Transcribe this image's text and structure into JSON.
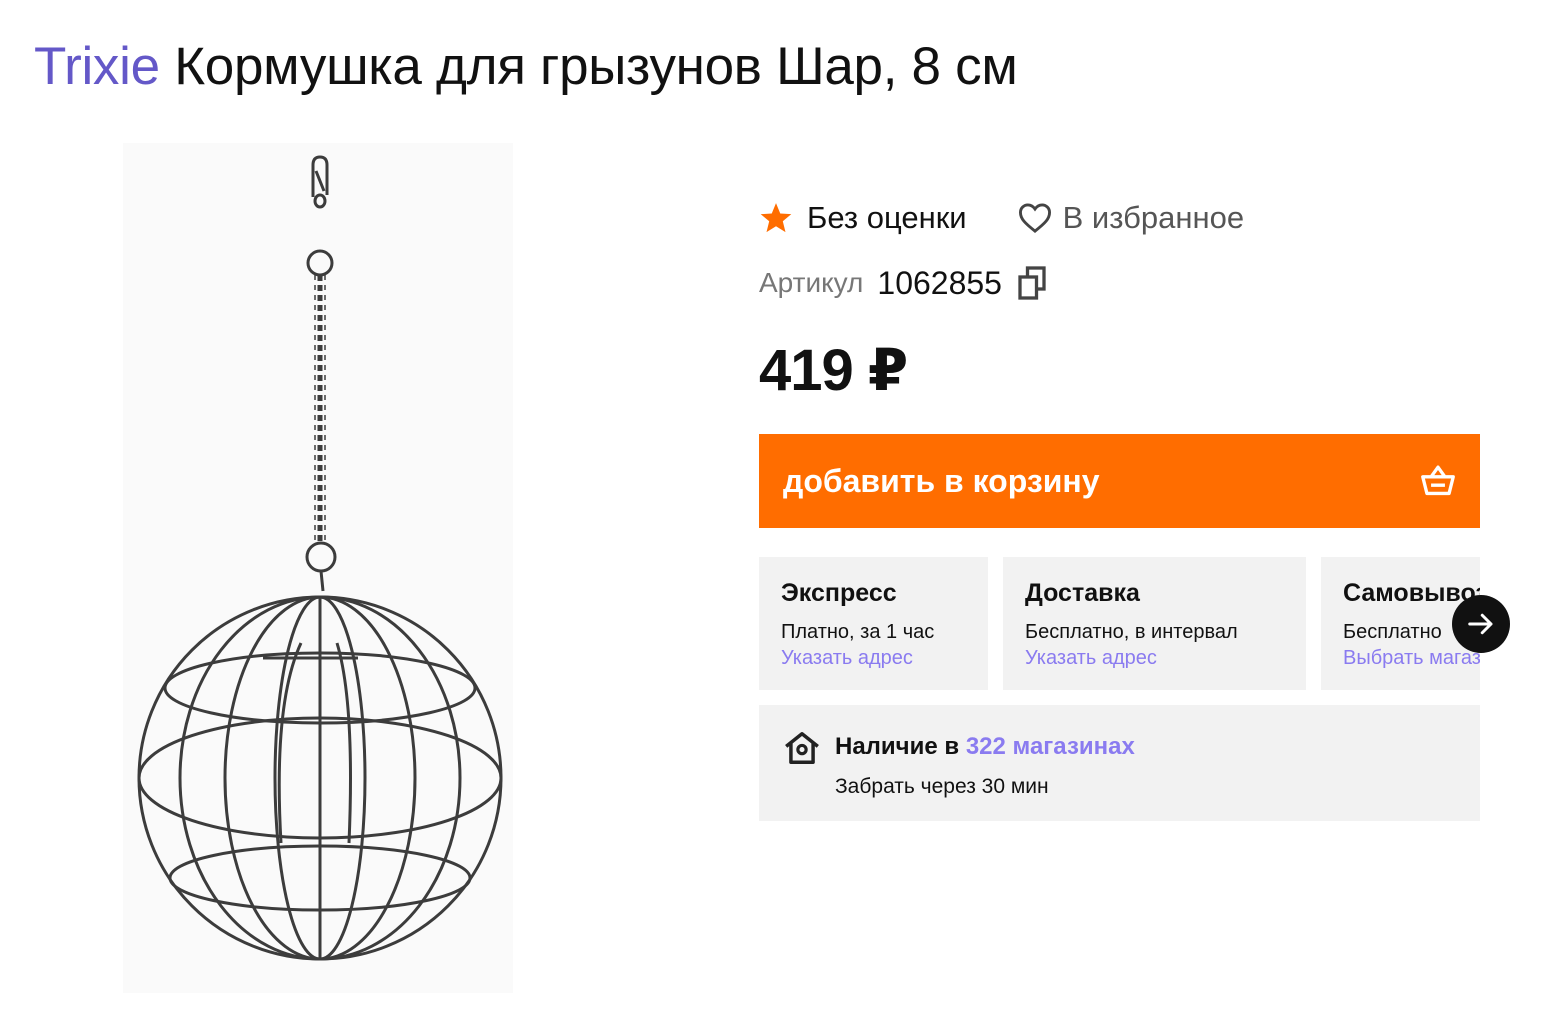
{
  "product": {
    "brand": "Trixie",
    "name": "Кормушка для грызунов Шар, 8 см",
    "image_alt_icon": "hanging-ball-feeder-image"
  },
  "rating": {
    "icon": "star-icon",
    "text": "Без оценки"
  },
  "favorites": {
    "icon": "heart-icon",
    "label": "В избранное"
  },
  "sku": {
    "label": "Артикул",
    "value": "1062855",
    "icon": "copy-icon"
  },
  "price": "419 ₽",
  "cart": {
    "label": "добавить в корзину",
    "icon": "basket-icon"
  },
  "delivery": [
    {
      "title": "Экспресс",
      "subtitle": "Платно, за 1 час",
      "link": "Указать адрес"
    },
    {
      "title": "Доставка",
      "subtitle": "Бесплатно, в интервал",
      "link": "Указать адрес"
    },
    {
      "title": "Самовывоз",
      "subtitle": "Бесплатно",
      "link": "Выбрать магазин"
    }
  ],
  "stock": {
    "prefix": "Наличие в",
    "link": "322 магазинах",
    "subtitle": "Забрать через 30 мин",
    "icon": "store-icon"
  },
  "colors": {
    "brand": "#6458c8",
    "accent": "#ff6d00",
    "link": "#8a7bf0",
    "card_bg": "#f2f2f2"
  }
}
